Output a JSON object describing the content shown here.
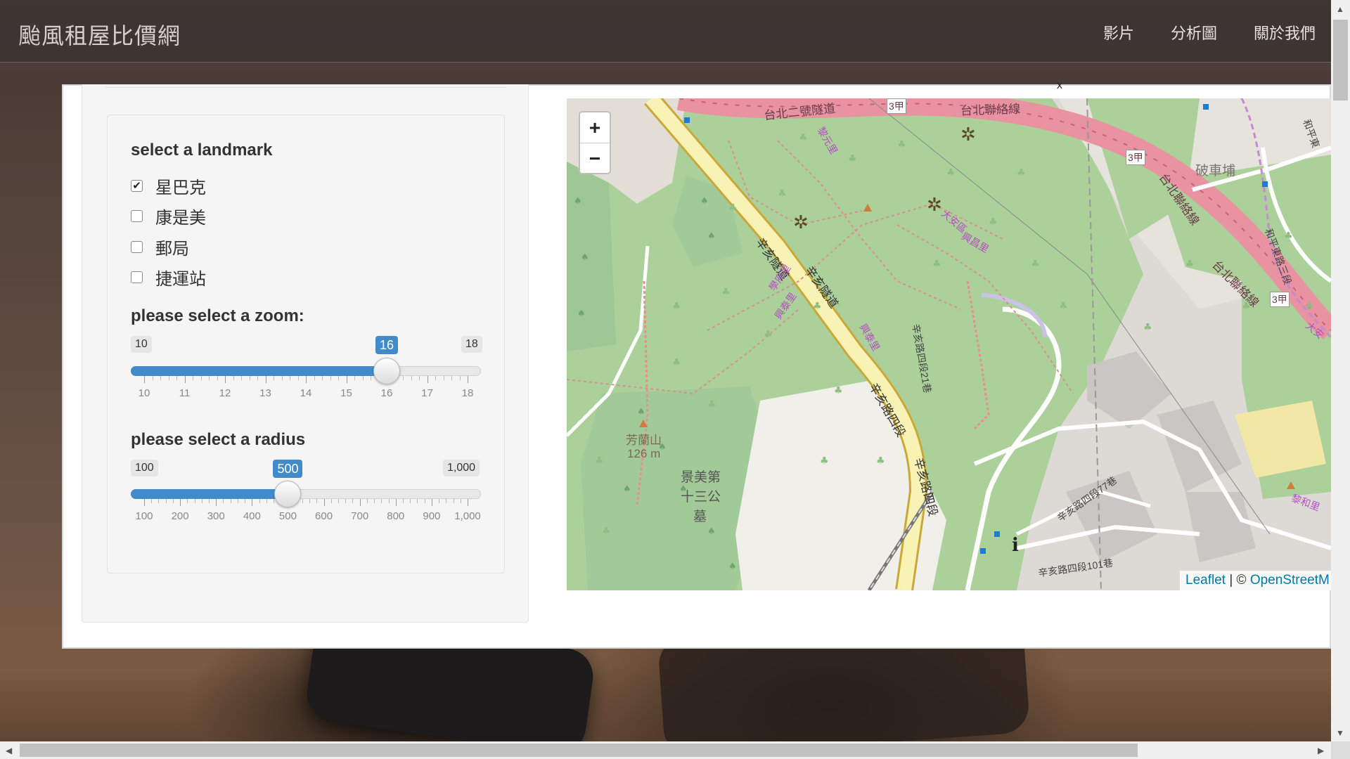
{
  "navbar": {
    "brand": "颱風租屋比價網",
    "links": [
      "影片",
      "分析圖",
      "關於我們"
    ]
  },
  "sidebar": {
    "landmark": {
      "label": "select a landmark",
      "options": [
        {
          "label": "星巴克",
          "checked": true
        },
        {
          "label": "康是美",
          "checked": false
        },
        {
          "label": "郵局",
          "checked": false
        },
        {
          "label": "捷運站",
          "checked": false
        }
      ]
    },
    "zoom": {
      "label": "please select a zoom:",
      "min": "10",
      "max": "18",
      "value": "16",
      "value_num": 16,
      "min_num": 10,
      "max_num": 18,
      "ticks": [
        "10",
        "11",
        "12",
        "13",
        "14",
        "15",
        "16",
        "17",
        "18"
      ]
    },
    "radius": {
      "label": "please select a radius",
      "min": "100",
      "max": "1,000",
      "value": "500",
      "value_num": 500,
      "min_num": 100,
      "max_num": 1000,
      "ticks": [
        "100",
        "200",
        "300",
        "400",
        "500",
        "600",
        "700",
        "800",
        "900",
        "1,000"
      ]
    }
  },
  "map": {
    "close_glyph": "x",
    "zoom_in": "+",
    "zoom_out": "−",
    "attribution": {
      "leaflet": "Leaflet",
      "separator": " | © ",
      "osm": "OpenStreetM"
    },
    "labels": {
      "road_1": "台北二號隧道",
      "road_2": "台北聯絡線",
      "road_3": "台北聯絡線",
      "road_4": "台北聯絡線",
      "route_3a": "3甲",
      "route_3b": "3甲",
      "route_3c": "3甲",
      "place_pocheibu": "破車埔",
      "tunnel": "辛亥隧道",
      "tunnel_2": "辛亥隧道",
      "road_xinhai4": "辛亥路四段",
      "road_xinhai4b": "辛亥路四段",
      "lane_21": "辛亥路四段21巷",
      "lane_77": "辛亥路四段77巷",
      "lane_101": "辛亥路四段101巷",
      "mountain": "芳蘭山",
      "elevation": "126 m",
      "cemetery_1": "景美第",
      "cemetery_2": "十三公",
      "cemetery_3": "墓",
      "li_1": "學府里",
      "li_2": "興泰里",
      "li_3": "興泰里",
      "li_4": "大安區",
      "li_5": "興昌里",
      "li_6": "黎元里",
      "li_7": "黎和里",
      "road_heping": "和平東路三段",
      "road_heping2": "和平東",
      "district_daan": "大安"
    }
  },
  "colors": {
    "accent": "#428bca",
    "navbar": "#3c3432",
    "map_park": "#acd09a",
    "map_highway": "#e892a2"
  }
}
